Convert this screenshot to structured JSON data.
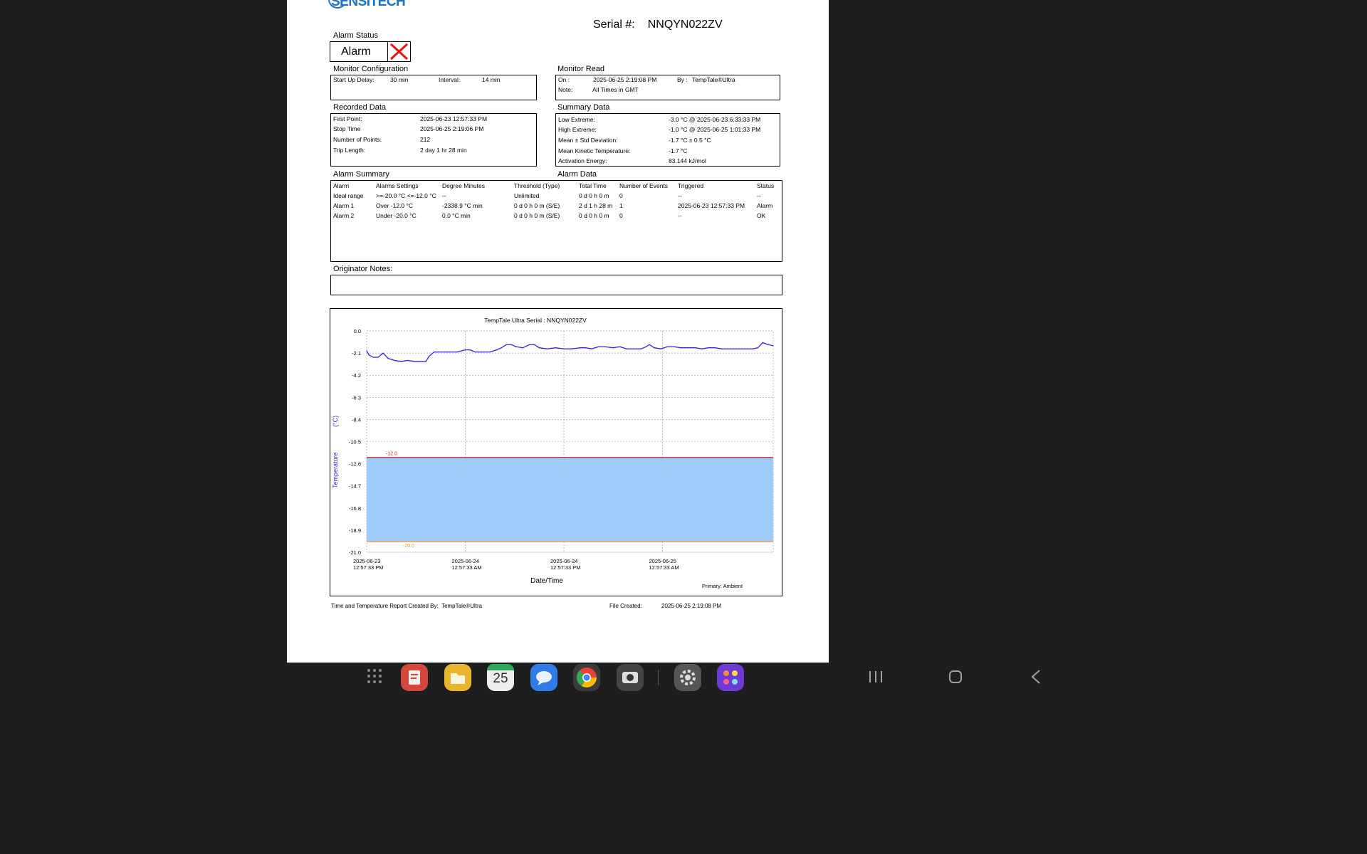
{
  "document": {
    "logo_text": "SENSITECH",
    "serial_label": "Serial #:",
    "serial_value": "NNQYN022ZV",
    "alarm_status": {
      "title": "Alarm Status",
      "value": "Alarm"
    },
    "monitor_configuration": {
      "title": "Monitor Configuration",
      "start_up_delay_label": "Start Up Delay:",
      "start_up_delay_value": "30 min",
      "interval_label": "Interval:",
      "interval_value": "14 min"
    },
    "monitor_read": {
      "title": "Monitor Read",
      "on_label": "On :",
      "on_value": "2025-06-25  2:19:08 PM",
      "by_label": "By :",
      "by_value": "TempTale®Ultra",
      "note_label": "Note:",
      "note_value": "All Times in GMT"
    },
    "recorded_data": {
      "title": "Recorded Data",
      "rows": [
        {
          "label": "First Point:",
          "value": "2025-06-23 12:57:33 PM"
        },
        {
          "label": "Stop Time",
          "value": "2025-06-25  2:19:06 PM"
        },
        {
          "label": "Number of Points:",
          "value": "212"
        },
        {
          "label": "Trip Length:",
          "value": "2 day 1 hr 28 min"
        }
      ]
    },
    "summary_data": {
      "title": "Summary Data",
      "rows": [
        {
          "label": "Low Extreme:",
          "value": "-3.0 °C @ 2025-06-23  6:33:33 PM"
        },
        {
          "label": "High Extreme:",
          "value": "-1.0 °C @ 2025-06-25  1:01:33 PM"
        },
        {
          "label": "Mean ± Std Deviation:",
          "value": "-1.7 °C ± 0.5 °C"
        },
        {
          "label": "Mean Kinetic Temperature:",
          "value": "-1.7 °C"
        },
        {
          "label": "Activation Energy:",
          "value": "83.144 kJ/mol"
        }
      ]
    },
    "alarm_summary": {
      "title": "Alarm Summary",
      "alarm_data_title": "Alarm Data",
      "headers": [
        "Alarm",
        "Alarms Settings",
        "Degree Minutes",
        "Threshold (Type)",
        "Total Time",
        "Number of Events",
        "Triggered",
        "Status"
      ],
      "rows": [
        [
          "Ideal range",
          ">=-20.0 °C <=-12.0 °C",
          "--",
          "Unlimited",
          "0 d 0 h 0 m",
          "0",
          "--",
          "--"
        ],
        [
          "Alarm 1",
          "Over -12.0 °C",
          "-2338.9 °C min",
          "0 d 0 h 0 m (S/E)",
          "2 d 1 h 28 m",
          "1",
          "2025-06-23 12:57:33 PM",
          "Alarm"
        ],
        [
          "Alarm 2",
          "Under -20.0 °C",
          "0.0 °C min",
          "0 d 0 h 0 m (S/E)",
          "0 d 0 h 0 m",
          "0",
          "--",
          "OK"
        ]
      ]
    },
    "originator_notes": {
      "title": "Originator Notes:",
      "value": ""
    },
    "footer": {
      "created_by_label": "Time and Temperature Report Created By:",
      "created_by_value": "TempTale®Ultra",
      "file_created_label": "File Created:",
      "file_created_value": "2025-06-25  2:19:08 PM"
    }
  },
  "chart_data": {
    "type": "line",
    "title": "TempTale Ultra  Serial : NNQYN022ZV",
    "xlabel": "Date/Time",
    "ylabel": "Temperature",
    "ylabel_unit": "(°C)",
    "yticks": [
      "0.0",
      "-2.1",
      "-4.2",
      "-6.3",
      "-8.4",
      "-10.5",
      "-12.6",
      "-14.7",
      "-16.8",
      "-18.9",
      "-21.0"
    ],
    "ylim": [
      -21.0,
      0.0
    ],
    "xticks": [
      {
        "date": "2025-06-23",
        "time": "12:57:33 PM"
      },
      {
        "date": "2025-06-24",
        "time": "12:57:33 AM"
      },
      {
        "date": "2025-06-24",
        "time": "12:57:33 PM"
      },
      {
        "date": "2025-06-25",
        "time": "12:57:33 AM"
      }
    ],
    "xlim_hours": [
      0,
      49.47
    ],
    "ideal_range": {
      "low": -20.0,
      "high": -12.0,
      "low_label": "-20.0",
      "high_label": "-12.0",
      "fill": "#9ecbfa",
      "high_color": "#cc2222",
      "low_color": "#ff8c2a"
    },
    "grid": true,
    "legend": "Primary: Ambient",
    "series": [
      {
        "color": "#3b1fe0",
        "points_hours": [
          [
            0,
            -1.9
          ],
          [
            0.3,
            -2.3
          ],
          [
            0.8,
            -2.5
          ],
          [
            1.4,
            -2.5
          ],
          [
            2.0,
            -2.1
          ],
          [
            2.6,
            -2.6
          ],
          [
            3.4,
            -2.8
          ],
          [
            4.2,
            -2.9
          ],
          [
            5.0,
            -2.8
          ],
          [
            5.8,
            -2.9
          ],
          [
            6.6,
            -2.9
          ],
          [
            7.2,
            -2.9
          ],
          [
            7.6,
            -2.4
          ],
          [
            8.2,
            -2.0
          ],
          [
            9.0,
            -2.0
          ],
          [
            10.0,
            -2.0
          ],
          [
            11.0,
            -2.0
          ],
          [
            12.0,
            -1.8
          ],
          [
            12.6,
            -1.8
          ],
          [
            13.2,
            -2.0
          ],
          [
            14.0,
            -2.0
          ],
          [
            15.0,
            -2.0
          ],
          [
            15.8,
            -1.8
          ],
          [
            16.4,
            -1.6
          ],
          [
            17.0,
            -1.3
          ],
          [
            17.6,
            -1.3
          ],
          [
            18.2,
            -1.5
          ],
          [
            19.0,
            -1.6
          ],
          [
            19.8,
            -1.3
          ],
          [
            20.4,
            -1.3
          ],
          [
            21.0,
            -1.6
          ],
          [
            22.0,
            -1.7
          ],
          [
            23.0,
            -1.6
          ],
          [
            24.0,
            -1.7
          ],
          [
            25.0,
            -1.7
          ],
          [
            26.0,
            -1.6
          ],
          [
            26.6,
            -1.6
          ],
          [
            27.4,
            -1.7
          ],
          [
            28.2,
            -1.5
          ],
          [
            29.0,
            -1.5
          ],
          [
            30.0,
            -1.6
          ],
          [
            30.8,
            -1.5
          ],
          [
            31.6,
            -1.7
          ],
          [
            32.4,
            -1.7
          ],
          [
            33.4,
            -1.7
          ],
          [
            34.0,
            -1.5
          ],
          [
            34.4,
            -1.3
          ],
          [
            35.0,
            -1.6
          ],
          [
            35.8,
            -1.7
          ],
          [
            36.6,
            -1.5
          ],
          [
            37.4,
            -1.5
          ],
          [
            38.2,
            -1.6
          ],
          [
            39.0,
            -1.6
          ],
          [
            40.0,
            -1.6
          ],
          [
            40.8,
            -1.7
          ],
          [
            41.6,
            -1.6
          ],
          [
            42.4,
            -1.6
          ],
          [
            43.2,
            -1.7
          ],
          [
            44.0,
            -1.7
          ],
          [
            45.0,
            -1.7
          ],
          [
            46.0,
            -1.7
          ],
          [
            47.0,
            -1.7
          ],
          [
            47.6,
            -1.6
          ],
          [
            48.2,
            -1.1
          ],
          [
            48.8,
            -1.3
          ],
          [
            49.47,
            -1.4
          ]
        ]
      }
    ]
  },
  "taskbar": {
    "calendar_day": "25",
    "apps": [
      "all-apps",
      "notes",
      "files",
      "calendar",
      "messages",
      "chrome",
      "camera",
      "settings",
      "apps-folder"
    ]
  }
}
